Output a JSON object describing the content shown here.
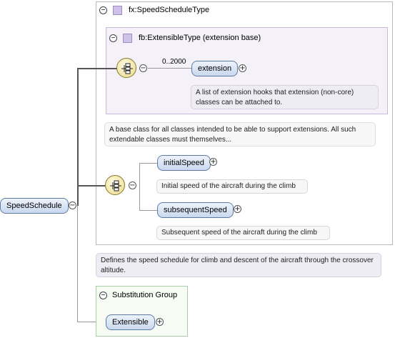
{
  "root_element": {
    "name": "SpeedSchedule"
  },
  "complex_type": {
    "title": "fx:SpeedScheduleType"
  },
  "extension_base": {
    "title": "fb:ExtensibleType (extension base)",
    "multiplicity": "0..2000",
    "element": "extension",
    "doc": "A list of extension hooks that extension (non-core) classes can be attached to.",
    "base_doc": "A base class for all classes intended to be able to support extensions. All such extendable classes must themselves..."
  },
  "sequence_items": [
    {
      "name": "initialSpeed",
      "doc": "Initial speed of the aircraft during the climb"
    },
    {
      "name": "subsequentSpeed",
      "doc": "Subsequent speed of the aircraft during the climb"
    }
  ],
  "type_doc": "Defines the speed schedule for climb and descent of the aircraft through the crossover altitude.",
  "substitution_group": {
    "title": "Substitution Group",
    "element": "Extensible"
  },
  "icons": {
    "collapse": "minus-icon",
    "expand": "plus-icon",
    "sequence": "sequence-icon",
    "type": "type-icon"
  },
  "colors": {
    "element_border": "#5b7ba6",
    "element_fill": "#c9d8ee",
    "sequence_fill": "#efe3a2",
    "subst_border": "#a9cfa9"
  }
}
